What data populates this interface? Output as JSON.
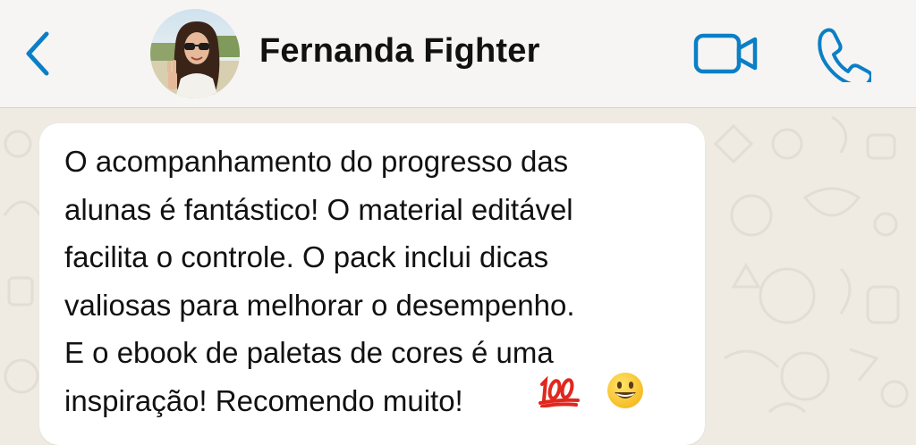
{
  "header": {
    "contact_name": "Fernanda Fighter",
    "back_icon": "chevron-left-icon",
    "video_icon": "video-camera-icon",
    "call_icon": "phone-icon",
    "accent_color": "#0b7fc6"
  },
  "message": {
    "text": "O acompanhamento do progresso das\nalunas é fantástico! O material editável\nfacilita o controle. O pack inclui dicas\nvaliosas para melhorar o desempenho.\nE o ebook de paletas de cores é uma\ninspiração! Recomendo muito!",
    "emojis": [
      "hundred-points-emoji",
      "grinning-face-emoji"
    ]
  },
  "colors": {
    "chat_background": "#efeae2",
    "bubble": "#ffffff",
    "header_background": "#f6f5f3"
  }
}
